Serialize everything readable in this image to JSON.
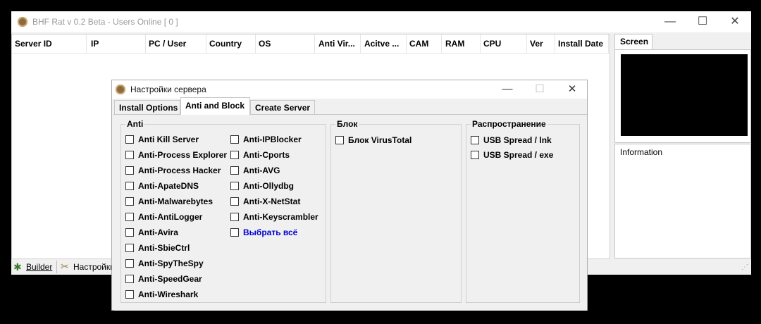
{
  "main_window": {
    "title": "BHF Rat v 0.2 Beta - Users Online [ 0 ]",
    "minimize_glyph": "—",
    "maximize_glyph": "☐",
    "close_glyph": "✕",
    "columns": [
      "Server ID",
      "IP",
      "PC / User",
      "Country",
      "OS",
      "Anti Vir...",
      "Acitve ...",
      "CAM",
      "RAM",
      "CPU",
      "Ver",
      "Install Date"
    ],
    "screen_tab": "Screen",
    "information_label": "Information",
    "status": {
      "builder": "Builder",
      "settings": "Настройки"
    }
  },
  "dialog": {
    "title": "Настройки сервера",
    "minimize_glyph": "—",
    "maximize_glyph": "☐",
    "close_glyph": "✕",
    "tabs": [
      "Install Options",
      "Anti and Block",
      "Create Server"
    ],
    "active_tab": "Anti and Block",
    "anti_group": {
      "label": "Anti",
      "col1": [
        "Anti Kill Server",
        "Anti-Process Explorer",
        "Anti-Process Hacker",
        "Anti-ApateDNS",
        "Anti-Malwarebytes",
        "Anti-AntiLogger",
        "Anti-Avira",
        "Anti-SbieCtrl",
        "Anti-SpyTheSpy",
        "Anti-SpeedGear",
        "Anti-Wireshark"
      ],
      "col2": [
        "Anti-IPBlocker",
        "Anti-Cports",
        "Anti-AVG",
        "Anti-Ollydbg",
        "Anti-X-NetStat",
        "Anti-Keyscrambler"
      ],
      "select_all": "Выбрать всё"
    },
    "block_group": {
      "label": "Блок",
      "items": [
        "Блок VirusTotal"
      ]
    },
    "spread_group": {
      "label": "Распространение",
      "items": [
        "USB Spread / lnk",
        "USB Spread / exe"
      ]
    }
  },
  "colors": {
    "link": "#0000cc",
    "background": "#000000",
    "window": "#f0f0f0"
  }
}
